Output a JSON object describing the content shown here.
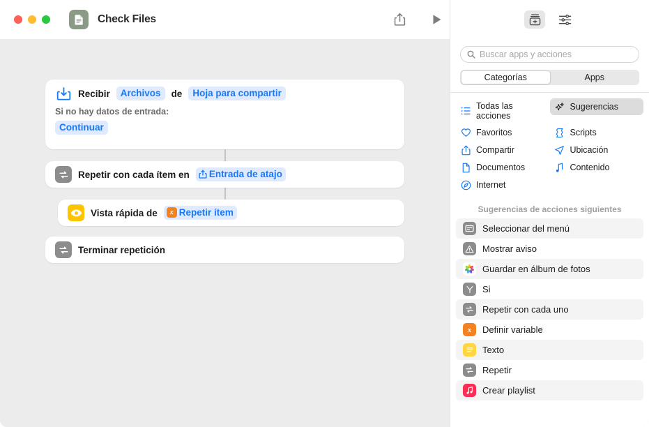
{
  "window": {
    "title": "Check Files",
    "doc_icon": "document-icon",
    "traffic_lights": [
      "close-red",
      "minimize-yellow",
      "zoom-green"
    ],
    "share_icon": "share-icon",
    "run_icon": "play-icon"
  },
  "panel_header": {
    "library_icon": "action-library-icon",
    "settings_icon": "sliders-icon"
  },
  "canvas": {
    "actions": [
      {
        "id": "receive",
        "icon": "receive-input-icon",
        "parts": [
          {
            "type": "text",
            "value": "Recibir"
          },
          {
            "type": "token",
            "value": "Archivos"
          },
          {
            "type": "text",
            "value": "de"
          },
          {
            "type": "token",
            "value": "Hoja para compartir"
          }
        ],
        "sub_label": "Si no hay datos de entrada:",
        "sub_token": "Continuar"
      },
      {
        "id": "repeat-each",
        "icon": "repeat-icon",
        "parts": [
          {
            "type": "text",
            "value": "Repetir con cada ítem en"
          },
          {
            "type": "token_share",
            "value": "Entrada de atajo"
          }
        ]
      },
      {
        "id": "quick-look",
        "icon": "eye-icon",
        "parts": [
          {
            "type": "text",
            "value": "Vista rápida de"
          },
          {
            "type": "token_var",
            "value": "Repetir ítem",
            "chip": "x"
          }
        ]
      },
      {
        "id": "end-repeat",
        "icon": "repeat-icon",
        "parts": [
          {
            "type": "text",
            "value": "Terminar repetición"
          }
        ]
      }
    ]
  },
  "sidebar": {
    "search": {
      "placeholder": "Buscar apps y acciones",
      "value": "",
      "icon": "search-icon"
    },
    "segmented": {
      "options": [
        "Categorías",
        "Apps"
      ],
      "selected": "Categorías"
    },
    "categories": [
      {
        "label": "Todas las acciones",
        "icon": "list-icon",
        "selected": false
      },
      {
        "label": "Sugerencias",
        "icon": "sparkles-icon",
        "selected": true
      },
      {
        "label": "Favoritos",
        "icon": "heart-icon",
        "selected": false
      },
      {
        "label": "Scripts",
        "icon": "scroll-icon",
        "selected": false
      },
      {
        "label": "Compartir",
        "icon": "share-icon",
        "selected": false
      },
      {
        "label": "Ubicación",
        "icon": "location-arrow-icon",
        "selected": false
      },
      {
        "label": "Documentos",
        "icon": "document-icon",
        "selected": false
      },
      {
        "label": "Contenido",
        "icon": "music-note-icon",
        "selected": false
      },
      {
        "label": "Internet",
        "icon": "safari-compass-icon",
        "selected": false
      }
    ],
    "suggestions_heading": "Sugerencias de acciones siguientes",
    "suggestions": [
      {
        "label": "Seleccionar del menú",
        "icon": "menu-select-icon",
        "icon_color": "#8c8c8c",
        "alt": true
      },
      {
        "label": "Mostrar aviso",
        "icon": "alert-icon",
        "icon_color": "#8c8c8c",
        "alt": false
      },
      {
        "label": "Guardar en álbum de fotos",
        "icon": "photos-icon",
        "icon_color": "#ffffff",
        "alt": true
      },
      {
        "label": "Si",
        "icon": "if-branch-icon",
        "icon_color": "#8c8c8c",
        "alt": false
      },
      {
        "label": "Repetir con cada uno",
        "icon": "repeat-icon",
        "icon_color": "#8c8c8c",
        "alt": true
      },
      {
        "label": "Definir variable",
        "icon": "variable-icon",
        "icon_color": "#f58220",
        "alt": false
      },
      {
        "label": "Texto",
        "icon": "text-icon",
        "icon_color": "#ffd63d",
        "alt": true
      },
      {
        "label": "Repetir",
        "icon": "repeat-icon",
        "icon_color": "#8c8c8c",
        "alt": false
      },
      {
        "label": "Crear playlist",
        "icon": "music-icon",
        "icon_color": "#fc2d55",
        "alt": true
      }
    ]
  },
  "colors": {
    "accent_blue": "#1779f6",
    "token_bg": "#dfeaff",
    "canvas_bg": "#ececec",
    "doc_green": "#8a9a86",
    "orange": "#f58220",
    "yellow": "#ffc400"
  }
}
